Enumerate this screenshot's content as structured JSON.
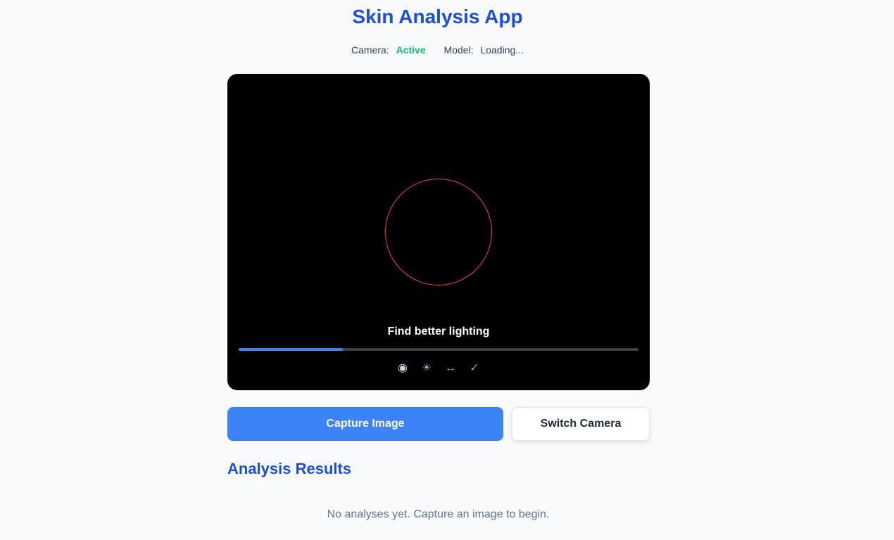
{
  "app": {
    "title": "Skin Analysis App"
  },
  "status": {
    "camera_label": "Camera:",
    "camera_value": "Active",
    "model_label": "Model:",
    "model_value": "Loading..."
  },
  "viewer": {
    "guidance_text": "Find better lighting",
    "progress": 0.26,
    "guide_circle_color": "#ef4444",
    "steps": [
      {
        "icon": "record-icon",
        "glyph": "◉",
        "active": true
      },
      {
        "icon": "sun-icon",
        "glyph": "☀",
        "active": false
      },
      {
        "icon": "arrows-horizontal-icon",
        "glyph": "↔",
        "active": false
      },
      {
        "icon": "check-icon",
        "glyph": "✓",
        "active": false
      }
    ]
  },
  "actions": {
    "capture_label": "Capture Image",
    "switch_label": "Switch Camera"
  },
  "results": {
    "title": "Analysis Results",
    "empty_message": "No analyses yet. Capture an image to begin."
  },
  "colors": {
    "accent": "#3b82f6",
    "heading": "#1d4ed8",
    "status_active": "#10b981"
  }
}
